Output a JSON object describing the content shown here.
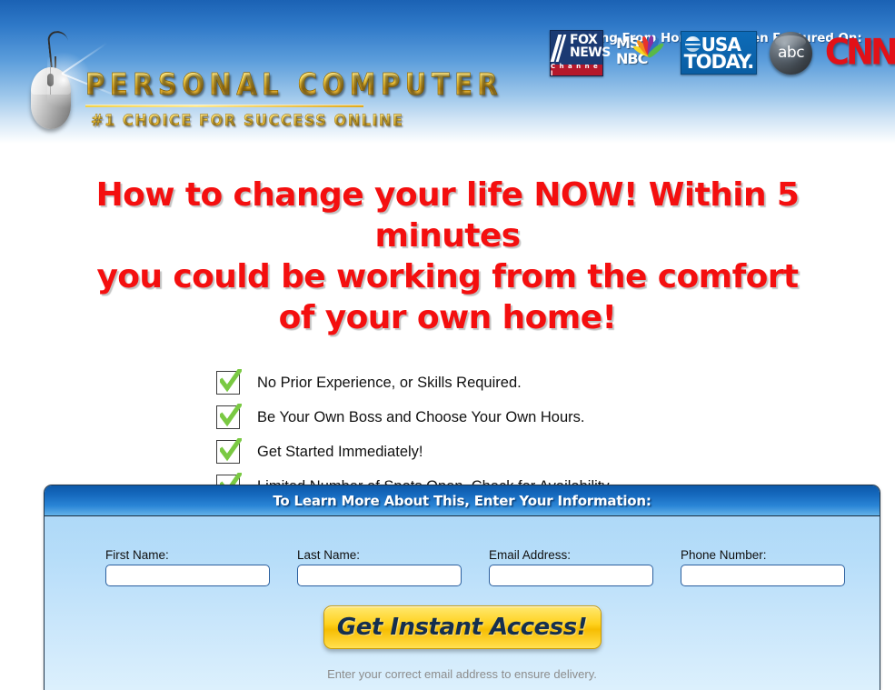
{
  "header": {
    "logo": {
      "icon": "computer-mouse-icon",
      "title": "PERSONAL COMPUTER",
      "subtitle": "#1 CHOICE FOR SUCCESS ONLINE",
      "title_color": "#ffd84a",
      "subtitle_color": "#ffd650"
    },
    "featured": {
      "title": "Working From Home Has Been Featured On:",
      "logos": [
        {
          "name": "fox-news-logo",
          "line1": "FOX",
          "line2": "NEWS",
          "banner": "C h a n n e l",
          "bg": "#1b3a73",
          "banner_bg": "#b5182b"
        },
        {
          "name": "msnbc-logo",
          "line1": "MS",
          "line2": "NBC",
          "feather_colors": [
            "#f6d623",
            "#f28b1c",
            "#e8322b",
            "#8b2fa0",
            "#2f73c2",
            "#59b948"
          ]
        },
        {
          "name": "usa-today-logo",
          "line1": "USA",
          "line2": "TODAY.",
          "bg": "#0d6bb8"
        },
        {
          "name": "abc-logo",
          "text": "abc"
        },
        {
          "name": "cnn-logo",
          "text": "CNN",
          "color": "#e21118"
        }
      ]
    },
    "gradient_top": "#1b62b4",
    "gradient_bottom": "#ffffff"
  },
  "headline": {
    "line1": "How to change your life NOW! Within 5 minutes",
    "line2": "you could be working from the comfort",
    "line3": "of your own home!",
    "color": "#f40f0f"
  },
  "bullets": [
    {
      "icon": "green-checkmark-icon",
      "text": "No Prior Experience, or Skills Required."
    },
    {
      "icon": "green-checkmark-icon",
      "text": "Be Your Own Boss and Choose Your Own Hours."
    },
    {
      "icon": "green-checkmark-icon",
      "text": "Get Started Immediately!"
    },
    {
      "icon": "green-checkmark-icon",
      "text": "Limited Number of Spots Open, Check for Availability."
    }
  ],
  "check_color": "#7ac943",
  "form": {
    "header_title": "To Learn More About This, Enter Your Information:",
    "fields": [
      {
        "name": "first-name",
        "label": "First Name:",
        "value": "",
        "placeholder": ""
      },
      {
        "name": "last-name",
        "label": "Last Name:",
        "value": "",
        "placeholder": ""
      },
      {
        "name": "email-address",
        "label": "Email Address:",
        "value": "",
        "placeholder": ""
      },
      {
        "name": "phone-number",
        "label": "Phone Number:",
        "value": "",
        "placeholder": ""
      }
    ],
    "cta_label": "Get Instant Access!",
    "cta_color": "#ffd21f",
    "note": "Enter your correct email address to ensure delivery."
  }
}
